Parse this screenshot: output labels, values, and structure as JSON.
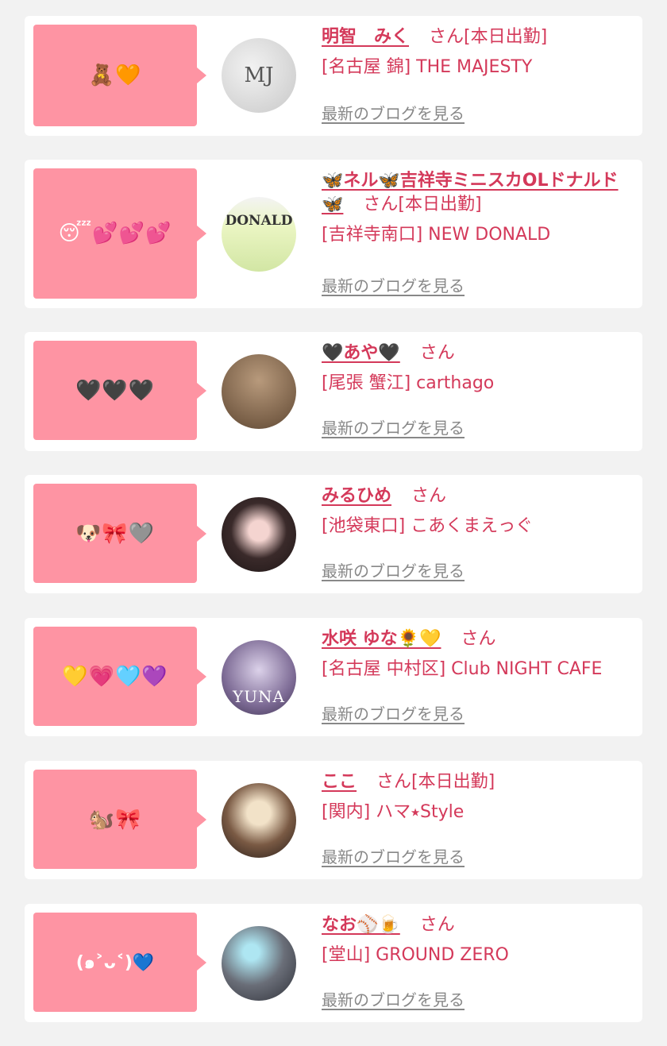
{
  "cards": [
    {
      "bubble": "🧸🧡",
      "name": "明智　みく",
      "san": "さん",
      "attendance": "[本日出勤]",
      "shop": "[名古屋 錦] THE MAJESTY",
      "blog": "最新のブログを見る",
      "avatar_text": "MJ"
    },
    {
      "bubble": "😴💕💕💕",
      "name": "🦋ネル🦋吉祥寺ミニスカOLドナルド🦋",
      "san": "さん",
      "attendance": "[本日出勤]",
      "shop": "[吉祥寺南口] NEW DONALD",
      "blog": "最新のブログを見る",
      "avatar_text": "DONALD"
    },
    {
      "bubble": "🖤🖤🖤",
      "name": "🖤あや🖤",
      "san": "さん",
      "attendance": "",
      "shop": "[尾張 蟹江] carthago",
      "blog": "最新のブログを見る",
      "avatar_text": ""
    },
    {
      "bubble": "🐶🎀🩶",
      "name": "みるひめ",
      "san": "さん",
      "attendance": "",
      "shop": "[池袋東口] こあくまえっぐ",
      "blog": "最新のブログを見る",
      "avatar_text": ""
    },
    {
      "bubble": "💛💗🩵💜",
      "name": "水咲 ゆな🌻💛",
      "san": "さん",
      "attendance": "",
      "shop": "[名古屋 中村区] Club NIGHT CAFE",
      "blog": "最新のブログを見る",
      "avatar_text": "YUNA"
    },
    {
      "bubble": "🐿️🎀",
      "name": "ここ",
      "san": "さん",
      "attendance": "[本日出勤]",
      "shop": "[関内] ハマ⭑Style",
      "blog": "最新のブログを見る",
      "avatar_text": ""
    },
    {
      "bubble": "(๑˃ᴗ˂)💙",
      "name": "なお⚾🍺",
      "san": "さん",
      "attendance": "",
      "shop": "[堂山] GROUND ZERO",
      "blog": "最新のブログを見る",
      "avatar_text": ""
    }
  ],
  "colors": {
    "accent": "#d4395a",
    "bubble": "#fe94a3",
    "link_gray": "#888888"
  }
}
